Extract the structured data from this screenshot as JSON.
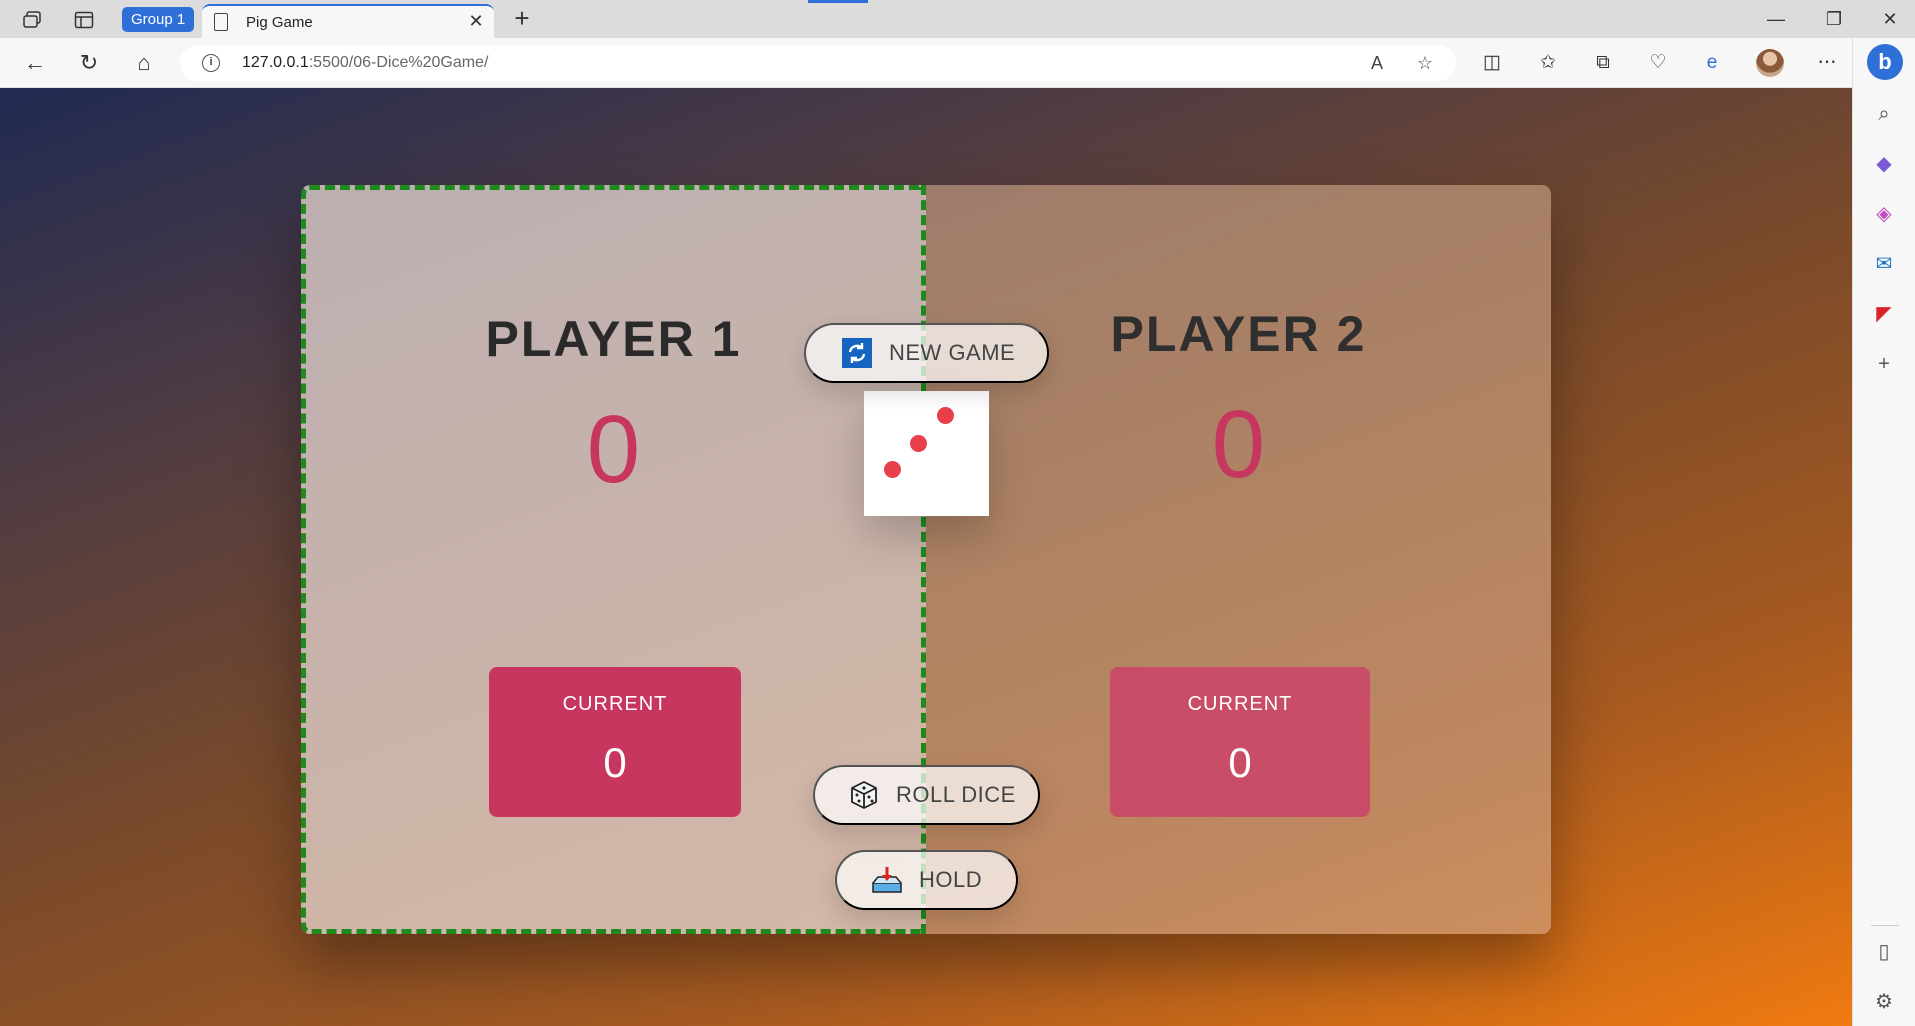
{
  "browser": {
    "group_label": "Group 1",
    "tab_title": "Pig Game",
    "tab_close": "✕",
    "new_tab": "+",
    "url_host": "127.0.0.1",
    "url_path": ":5500/06-Dice%20Game/"
  },
  "game": {
    "player1": {
      "name": "PLAYER 1",
      "score": "0",
      "current_label": "CURRENT",
      "current_score": "0",
      "active": true
    },
    "player2": {
      "name": "PLAYER 2",
      "score": "0",
      "current_label": "CURRENT",
      "current_score": "0",
      "active": false
    },
    "dice_value": 3,
    "buttons": {
      "new_game": "NEW GAME",
      "roll_dice": "ROLL DICE",
      "hold": "HOLD"
    }
  },
  "colors": {
    "active_border": "#1e8a1e",
    "score_color": "#c7365f",
    "current_bg": "#c7365f",
    "pip_color": "#e8404a"
  }
}
